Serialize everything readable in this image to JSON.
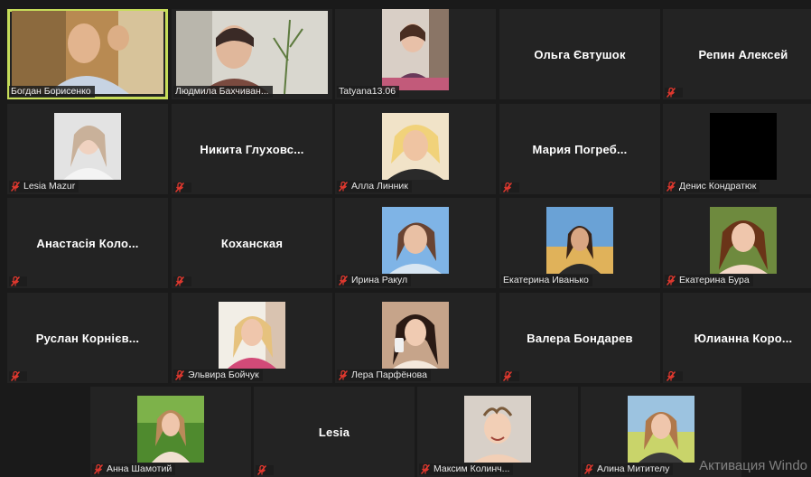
{
  "app": "Zoom",
  "colors": {
    "active_border": "#c6dd5a",
    "mic_muted": "#e5392f",
    "tile_bg": "#232323",
    "bg": "#1a1a1a"
  },
  "participants": [
    {
      "name": "Богдан Борисенко",
      "muted": false,
      "active": true,
      "video": true
    },
    {
      "name": "Людмила Бахчиван...",
      "muted": false,
      "video": true
    },
    {
      "name": "Tatyana13.06",
      "muted": false,
      "video": true
    },
    {
      "name": "Ольга Євтушок",
      "muted": true,
      "video": false
    },
    {
      "name": "Репин Алексей",
      "muted": true,
      "video": false
    },
    {
      "name": "Lesia Mazur",
      "muted": true,
      "video": true
    },
    {
      "name": "Никита Глуховс...",
      "muted": true,
      "video": false
    },
    {
      "name": "Алла Линник",
      "muted": true,
      "video": true
    },
    {
      "name": "Мария Погреб...",
      "muted": true,
      "video": false
    },
    {
      "name": "Денис Кондратюк",
      "muted": true,
      "video": true
    },
    {
      "name": "Анастасія Коло...",
      "muted": true,
      "video": false
    },
    {
      "name": "Коханская",
      "muted": true,
      "video": false
    },
    {
      "name": "Ирина Ракул",
      "muted": true,
      "video": true
    },
    {
      "name": "Екатерина Иванько",
      "muted": true,
      "video": true
    },
    {
      "name": "Екатерина Бура",
      "muted": true,
      "video": true
    },
    {
      "name": "Руслан Корнієв...",
      "muted": true,
      "video": false
    },
    {
      "name": "Эльвира Бойчук",
      "muted": true,
      "video": true
    },
    {
      "name": "Лера Парфёнова",
      "muted": true,
      "video": true
    },
    {
      "name": "Валера Бондарев",
      "muted": true,
      "video": false
    },
    {
      "name": "Юлианна Коро...",
      "muted": true,
      "video": false
    },
    {
      "name": "Анна Шамотий",
      "muted": true,
      "video": true
    },
    {
      "name": "Lesia",
      "muted": true,
      "video": false
    },
    {
      "name": "Максим Колинч...",
      "muted": true,
      "video": true
    },
    {
      "name": "Алина Митителу",
      "muted": true,
      "video": true
    }
  ],
  "watermark": "Активация Windo"
}
